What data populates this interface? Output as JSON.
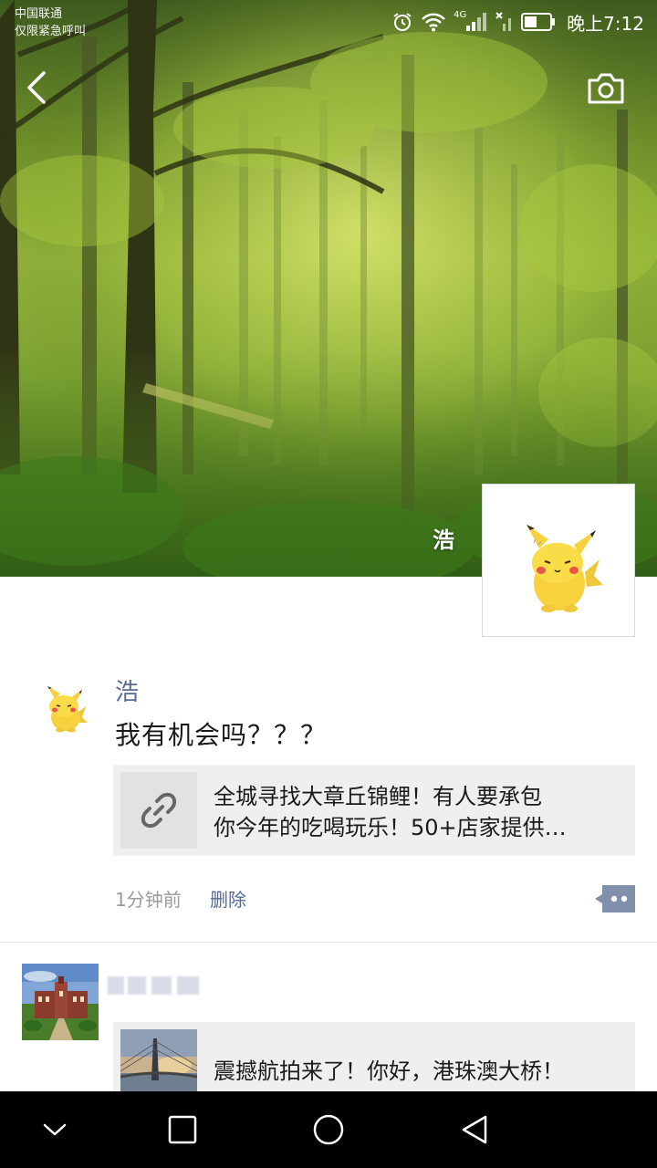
{
  "status_bar": {
    "carrier_line1": "中国联通",
    "carrier_line2": "仅限紧急呼叫",
    "network": "4G",
    "time": "晚上7:12",
    "icons": [
      "alarm-icon",
      "wifi-icon",
      "signal-icon",
      "no-sim-icon",
      "battery-icon"
    ]
  },
  "header": {
    "back_icon": "chevron-left-icon",
    "camera_icon": "camera-icon"
  },
  "cover": {
    "user_name": "浩",
    "avatar": "pikachu-avatar"
  },
  "posts": [
    {
      "author": "浩",
      "text": "我有机会吗？？？",
      "link": {
        "icon": "link-icon",
        "title_line1": "全城寻找大章丘锦鲤！有人要承包",
        "title_line2": "你今年的吃喝玩乐！50+店家提供…"
      },
      "time": "1分钟前",
      "delete_label": "删除",
      "more_icon": "comment-more-icon"
    },
    {
      "author": "",
      "link": {
        "title": "震撼航拍来了！你好，港珠澳大桥！"
      }
    }
  ],
  "nav": {
    "icons": [
      "collapse-icon",
      "recents-icon",
      "home-icon",
      "back-triangle-icon"
    ]
  }
}
